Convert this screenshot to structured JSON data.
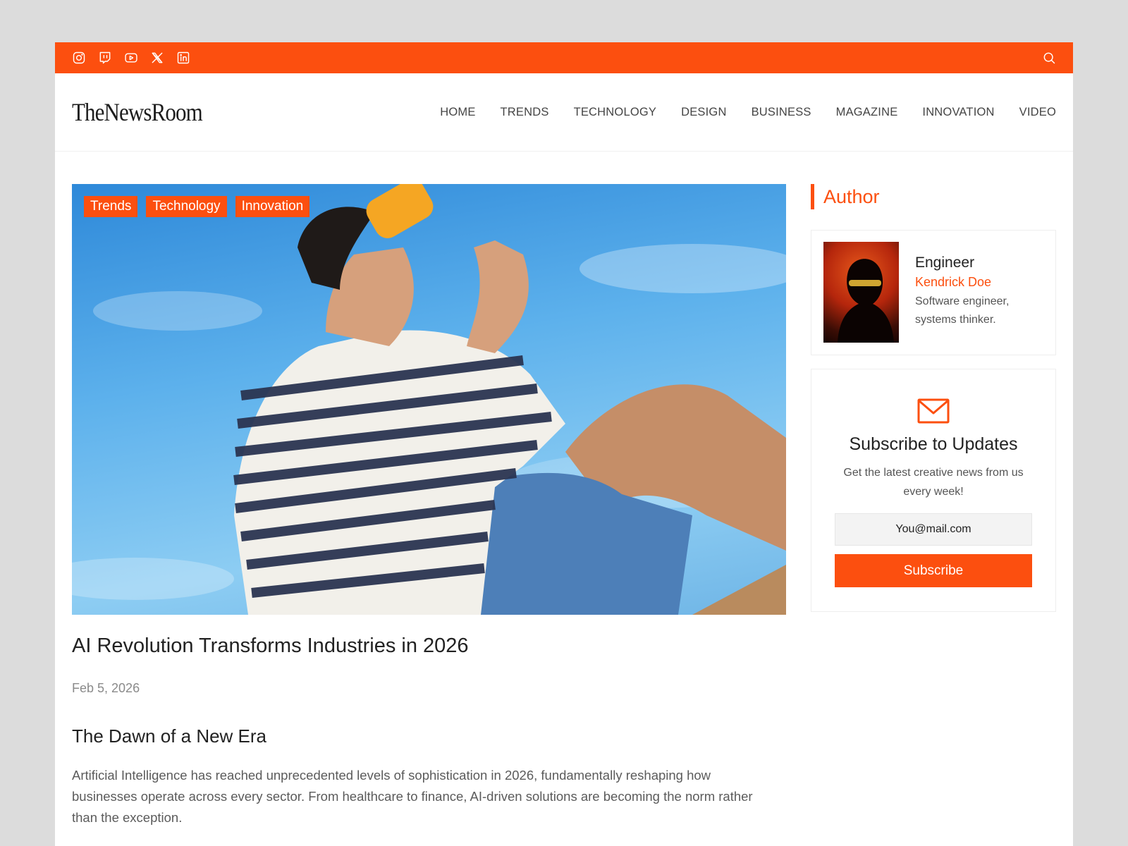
{
  "topbar": {
    "social_icons": [
      "instagram-icon",
      "twitch-icon",
      "youtube-icon",
      "x-icon",
      "linkedin-icon"
    ],
    "search_icon": "search-icon",
    "accent": "#fc4f0f"
  },
  "header": {
    "logo": "TheNewsRoom",
    "nav": [
      "HOME",
      "TRENDS",
      "TECHNOLOGY",
      "DESIGN",
      "BUSINESS",
      "MAGAZINE",
      "INNOVATION",
      "VIDEO"
    ]
  },
  "article": {
    "tags": [
      "Trends",
      "Technology",
      "Innovation"
    ],
    "title": "AI Revolution Transforms Industries in 2026",
    "date": "Feb 5, 2026",
    "subheading": "The Dawn of a New Era",
    "body": "Artificial Intelligence has reached unprecedented levels of sophistication in 2026, fundamentally reshaping how businesses operate across every sector. From healthcare to finance, AI-driven solutions are becoming the norm rather than the exception."
  },
  "sidebar": {
    "heading": "Author",
    "author": {
      "role": "Engineer",
      "name": "Kendrick Doe",
      "bio": "Software engineer, systems thinker."
    },
    "subscribe": {
      "icon": "mail-icon",
      "title": "Subscribe to Updates",
      "description": "Get the latest creative news from us every week!",
      "placeholder": "You@mail.com",
      "button": "Subscribe"
    }
  }
}
